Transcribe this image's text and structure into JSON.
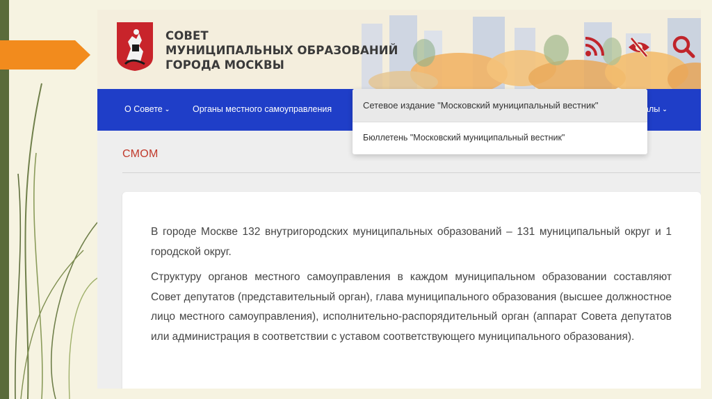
{
  "site": {
    "title_lines": [
      "СОВЕТ",
      "МУНИЦИПАЛЬНЫХ ОБРАЗОВАНИЙ",
      "ГОРОДА МОСКВЫ"
    ],
    "icons": [
      "rss-icon",
      "eye-slash-icon",
      "search-icon"
    ],
    "accent_color": "#c0242b",
    "nav_color": "#1f3ec8"
  },
  "nav": {
    "about": "О Совете",
    "organs": "Органы местного самоуправления",
    "materials_tail": "алы"
  },
  "dropdown": {
    "items": [
      "Сетевое издание \"Московский муниципальный вестник\"",
      "Бюллетень \"Московский муниципальный вестник\""
    ]
  },
  "page": {
    "heading": "СМОМ",
    "paragraphs": [
      "В городе Москве 132 внутригородских муниципальных образований – 131 муниципальный округ и 1 городской округ.",
      "Структуру органов местного самоуправления в каждом муниципальном образовании составляют Совет депутатов (представительный орган), глава муниципального образования (высшее должностное лицо местного самоуправления), исполнительно-распорядительный орган (аппарат Совета депутатов или администрация в соответствии с уставом соответствующего муниципального образования)."
    ]
  }
}
